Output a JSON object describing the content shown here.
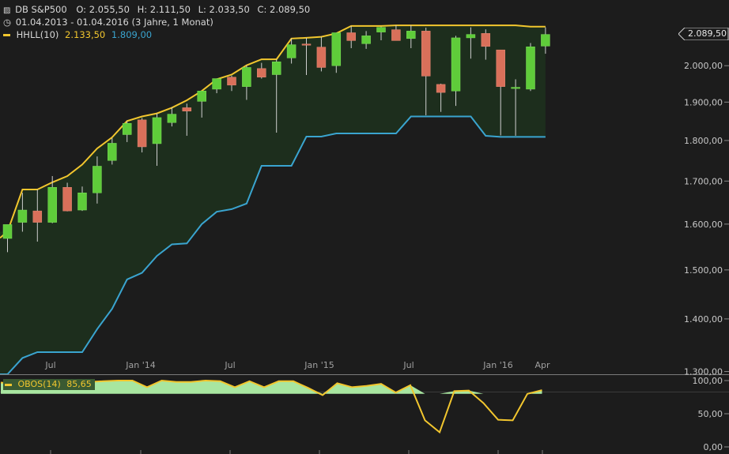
{
  "header": {
    "symbol": "DB S&P500",
    "ohlc": {
      "o": "O: 2.055,50",
      "h": "H: 2.111,50",
      "l": "L: 2.033,50",
      "c": "C: 2.089,50"
    },
    "range": "01.04.2013 - 01.04.2016 (3 Jahre, 1 Monat)",
    "indicator": {
      "name": "HHLL(10)",
      "upper": "2.133,50",
      "lower": "1.809,00"
    }
  },
  "colors": {
    "background": "#1c1c1c",
    "up": "#5fcc3a",
    "down": "#d9705a",
    "upper_band": "#f2c62e",
    "lower_band": "#3aa4cf",
    "band_fill": "#1d2e1d",
    "obos_fill": "#a8e6a0",
    "obos_line": "#f2c62e",
    "price_marker_bg": "#e0e0e0"
  },
  "price_marker": "2.089,50",
  "obos": {
    "label": "OBOS(14)",
    "value": "85,65"
  },
  "chart_data": [
    {
      "type": "candlestick",
      "title": "DB S&P500",
      "xlabel": "",
      "ylabel": "",
      "x_ticks": [
        "Jul",
        "Jan '14",
        "Jul",
        "Jan '15",
        "Jul",
        "Jan '16",
        "Apr"
      ],
      "y_ticks": [
        "1.300,00",
        "1.400,00",
        "1.500,00",
        "1.600,00",
        "1.700,00",
        "1.800,00",
        "1.900,00",
        "2.000,00"
      ],
      "ylim": [
        1295,
        2160
      ],
      "y_scale": "log",
      "candles": [
        {
          "o": 1568,
          "h": 1598,
          "l": 1538,
          "c": 1599
        },
        {
          "o": 1604,
          "h": 1672,
          "l": 1583,
          "c": 1632
        },
        {
          "o": 1630,
          "h": 1680,
          "l": 1561,
          "c": 1604
        },
        {
          "o": 1604,
          "h": 1712,
          "l": 1602,
          "c": 1685
        },
        {
          "o": 1685,
          "h": 1696,
          "l": 1629,
          "c": 1630
        },
        {
          "o": 1632,
          "h": 1687,
          "l": 1630,
          "c": 1672
        },
        {
          "o": 1672,
          "h": 1760,
          "l": 1647,
          "c": 1736
        },
        {
          "o": 1750,
          "h": 1806,
          "l": 1740,
          "c": 1793
        },
        {
          "o": 1815,
          "h": 1850,
          "l": 1796,
          "c": 1844
        },
        {
          "o": 1853,
          "h": 1858,
          "l": 1770,
          "c": 1784
        },
        {
          "o": 1792,
          "h": 1870,
          "l": 1737,
          "c": 1859
        },
        {
          "o": 1846,
          "h": 1886,
          "l": 1836,
          "c": 1868
        },
        {
          "o": 1885,
          "h": 1896,
          "l": 1812,
          "c": 1876
        },
        {
          "o": 1902,
          "h": 1925,
          "l": 1859,
          "c": 1930
        },
        {
          "o": 1935,
          "h": 1962,
          "l": 1924,
          "c": 1964
        },
        {
          "o": 1968,
          "h": 1972,
          "l": 1930,
          "c": 1946
        },
        {
          "o": 1942,
          "h": 2001,
          "l": 1906,
          "c": 1995
        },
        {
          "o": 1992,
          "h": 2008,
          "l": 1964,
          "c": 1968
        },
        {
          "o": 1975,
          "h": 2018,
          "l": 1820,
          "c": 2011
        },
        {
          "o": 2022,
          "h": 2078,
          "l": 2006,
          "c": 2060
        },
        {
          "o": 2062,
          "h": 2080,
          "l": 1974,
          "c": 2060
        },
        {
          "o": 2053,
          "h": 2083,
          "l": 1984,
          "c": 1995
        },
        {
          "o": 2000,
          "h": 2093,
          "l": 1980,
          "c": 2095
        },
        {
          "o": 2095,
          "h": 2115,
          "l": 2050,
          "c": 2072
        },
        {
          "o": 2063,
          "h": 2100,
          "l": 2048,
          "c": 2086
        },
        {
          "o": 2097,
          "h": 2113,
          "l": 2073,
          "c": 2111
        },
        {
          "o": 2104,
          "h": 2117,
          "l": 2079,
          "c": 2072
        },
        {
          "o": 2078,
          "h": 2117,
          "l": 2050,
          "c": 2100
        },
        {
          "o": 2100,
          "h": 2110,
          "l": 1865,
          "c": 1971
        },
        {
          "o": 1948,
          "h": 1950,
          "l": 1874,
          "c": 1926
        },
        {
          "o": 1930,
          "h": 2086,
          "l": 1890,
          "c": 2080
        },
        {
          "o": 2080,
          "h": 2111,
          "l": 2020,
          "c": 2090
        },
        {
          "o": 2093,
          "h": 2105,
          "l": 2017,
          "c": 2055
        },
        {
          "o": 2045,
          "h": 2045,
          "l": 1813,
          "c": 1942
        },
        {
          "o": 1940,
          "h": 1962,
          "l": 1812,
          "c": 1940
        },
        {
          "o": 1935,
          "h": 2065,
          "l": 1930,
          "c": 2054
        },
        {
          "o": 2056,
          "h": 2111,
          "l": 2034,
          "c": 2090
        }
      ],
      "series": [
        {
          "name": "HHLL(10)",
          "values": [
            1583,
            1680,
            1680,
            1697,
            1712,
            1740,
            1780,
            1808,
            1850,
            1862,
            1870,
            1885,
            1905,
            1930,
            1962,
            1975,
            2001,
            2018,
            2018,
            2078,
            2080,
            2083,
            2093,
            2115,
            2115,
            2115,
            2117,
            2117,
            2117,
            2117,
            2117,
            2117,
            2117,
            2117,
            2117,
            2113,
            2113
          ]
        },
        {
          "name": "",
          "values": [
            1295,
            1325,
            1336,
            1336,
            1336,
            1336,
            1380,
            1420,
            1480,
            1494,
            1530,
            1555,
            1557,
            1600,
            1628,
            1634,
            1647,
            1737,
            1737,
            1737,
            1810,
            1810,
            1818,
            1818,
            1818,
            1818,
            1818,
            1862,
            1862,
            1862,
            1862,
            1862,
            1812,
            1809,
            1809,
            1809,
            1809
          ]
        }
      ]
    },
    {
      "type": "area",
      "title": "",
      "ylim": [
        0,
        100
      ],
      "y_ticks": [
        "0,00",
        "50,00",
        "100,00"
      ],
      "series": [
        {
          "name": "OBOS(14)",
          "values": [
            97,
            95,
            92,
            98,
            98,
            93,
            98,
            99,
            100,
            100,
            90,
            100,
            98,
            98,
            100,
            99,
            90,
            99,
            90,
            99,
            99,
            89,
            78,
            96,
            90,
            92,
            95,
            82,
            93,
            40,
            22,
            84,
            85,
            66,
            41,
            40,
            80,
            85.65
          ]
        }
      ]
    }
  ]
}
